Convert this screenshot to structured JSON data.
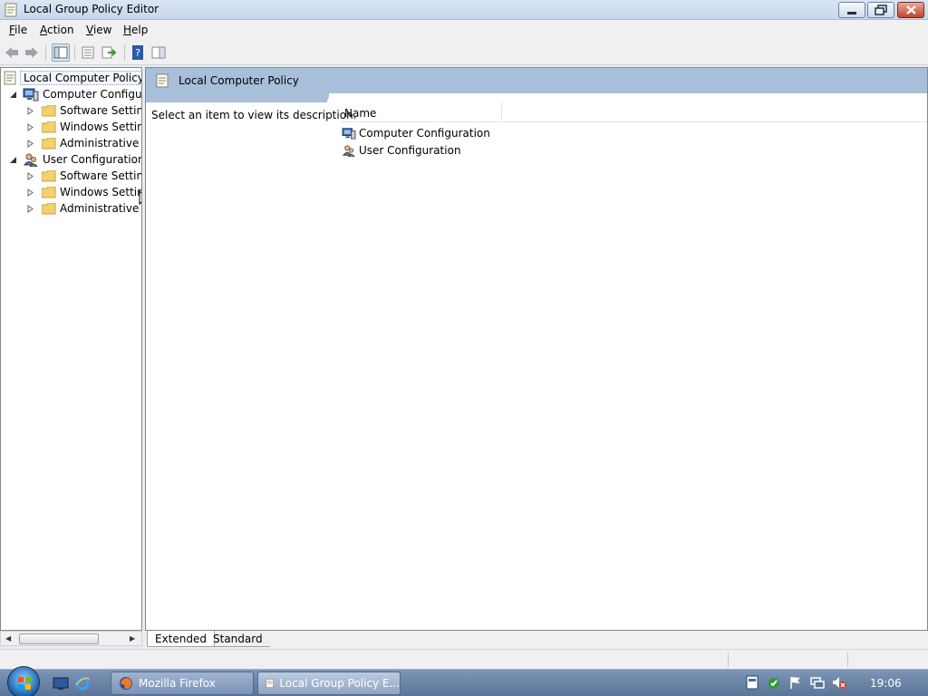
{
  "window": {
    "title": "Local Group Policy Editor"
  },
  "menu": [
    "File",
    "Action",
    "View",
    "Help"
  ],
  "tree": {
    "root": "Local Computer Policy",
    "computer_config": "Computer Configura",
    "computer_children": [
      "Software Settings",
      "Windows Setting",
      "Administrative Te"
    ],
    "user_config": "User Configuration",
    "user_children": [
      "Software Settings",
      "Windows Setting",
      "Administrative Te"
    ]
  },
  "right": {
    "header": "Local Computer Policy",
    "description": "Select an item to view its description.",
    "column_name": "Name",
    "items": [
      "Computer Configuration",
      "User Configuration"
    ]
  },
  "tabs": [
    "Extended",
    "Standard"
  ],
  "taskbar": {
    "firefox": "Mozilla Firefox",
    "gpedit": "Local Group Policy E...",
    "clock": "19:06"
  }
}
